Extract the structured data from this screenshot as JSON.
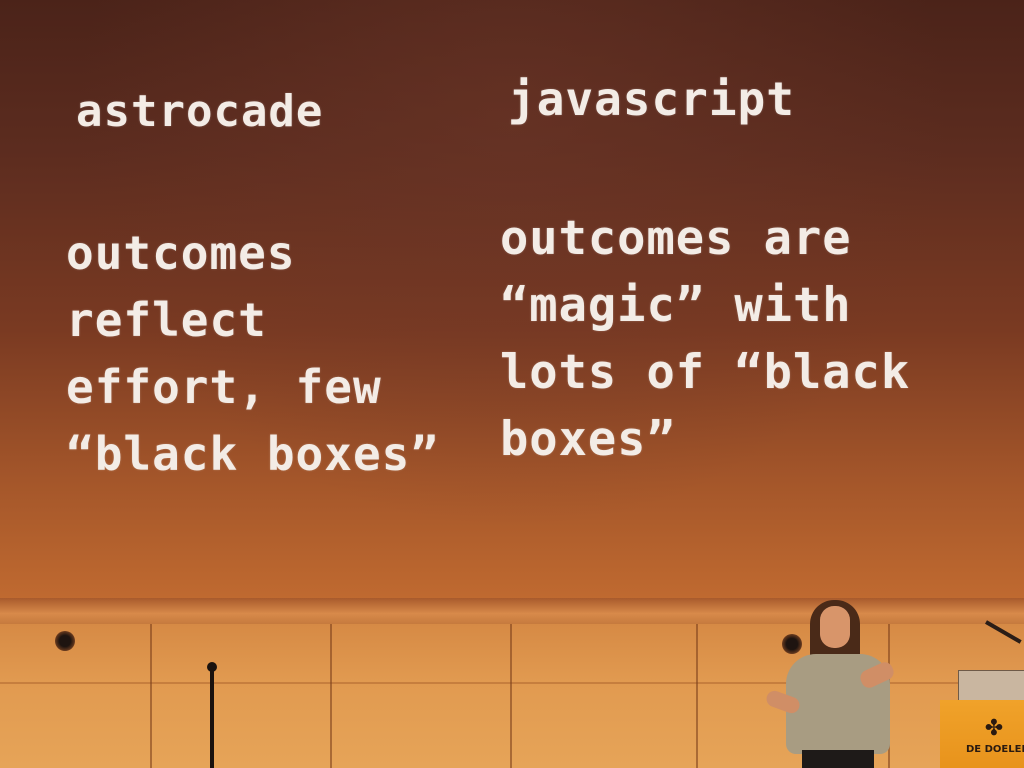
{
  "slide": {
    "left_heading": "astrocade",
    "right_heading": "javascript",
    "left_body": "outcomes\nreflect\neffort, few\n“black boxes”",
    "right_body": "outcomes are\n“magic” with\nlots of “black\nboxes”"
  },
  "podium": {
    "logo_text": "DE DOELEN",
    "logo_icon": "de-doelen-logo-icon"
  },
  "colors": {
    "slide_text": "#f3ece6",
    "screen_top": "#4b2319",
    "screen_bottom": "#c06a30",
    "podium": "#f0a22a"
  }
}
